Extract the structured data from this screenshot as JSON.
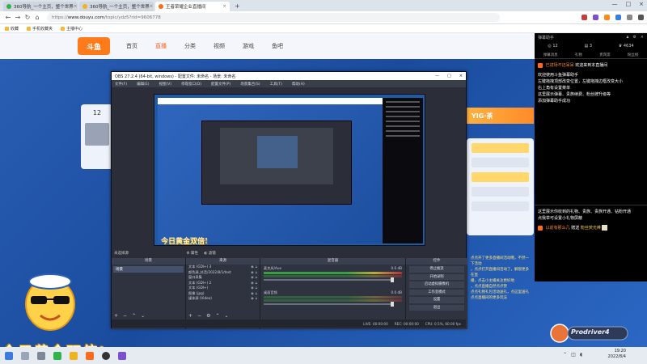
{
  "browser": {
    "tabs": [
      {
        "title": "360导航_一个主页，整个世界",
        "color": "#2fb34b",
        "active": false
      },
      {
        "title": "360导航_一个主页，整个世界",
        "color": "#f0b31e",
        "active": false
      },
      {
        "title": "王者荣耀企业直播间",
        "color": "#ff6a1a",
        "active": true
      }
    ],
    "newtab": "+",
    "url_prefix": "https://",
    "url_host": "www.douyu.com",
    "url_path": "/topic/ydz5?rid=9606778",
    "bookmarks": [
      "收藏",
      "手机收藏夹",
      "主播中心"
    ],
    "nav": {
      "back": "←",
      "forward": "→",
      "reload": "↻",
      "home": "⌂"
    }
  },
  "site": {
    "logo": "斗鱼",
    "nav": [
      "首页",
      "直播",
      "分类",
      "视频",
      "游戏",
      "鱼吧"
    ],
    "active_nav": 1,
    "left_card_num": "12",
    "yig_banner": "YIG·茶",
    "promo_lines": [
      "点点开了更多直播间活动哦，不然一下活动",
      "，点点打开直播间活动了，解锁更多在直",
      "播，点击小主播关注更好地",
      "，点点直播自然点点赞",
      "点点礼物礼包活动送礼，点这里送礼",
      "点点直播间的更多玩法"
    ],
    "gold_text": "今日黄金双倍!",
    "brand": "Prodriver4"
  },
  "obs": {
    "title": "OBS 27.2.4 (64-bit, windows) - 配置文件: 未命名 - 场景: 未命名",
    "menu": [
      "文件(F)",
      "编辑(E)",
      "视图(V)",
      "停靠窗口(D)",
      "配置文件(P)",
      "场景集合(S)",
      "工具(T)",
      "帮助(H)"
    ],
    "preview_label": "未选择源",
    "filter_buttons": [
      "属性",
      "滤镜"
    ],
    "panels": {
      "scenes": "场景",
      "sources": "来源",
      "mixer": "混音器",
      "controls": "控件"
    },
    "scene_items": [
      "场景"
    ],
    "sources": [
      "文本 (GDI+) 3",
      "颜色源_抖音/2022/8/1/test",
      "窗口采集",
      "文本 (GDI+) 2",
      "文本 (GDI+)",
      "图像 (jpg)",
      "媒体源 (Video)"
    ],
    "mixer_channels": [
      {
        "name": "麦克风/Aux",
        "db": "0.0 dB"
      },
      {
        "name": "桌面音频",
        "db": "0.0 dB"
      }
    ],
    "controls": [
      "停止推流",
      "开始录制",
      "启动虚拟摄像机",
      "工作室模式",
      "设置",
      "退出"
    ],
    "status": [
      "LIVE: 00:00:00",
      "REC: 00:00:00",
      "CPU: 0.5%, 60.00 fps"
    ],
    "mini_gold": "今日黄金双倍!"
  },
  "chat": {
    "header": "弹幕助手",
    "stats": [
      "12",
      "3",
      "4634"
    ],
    "tabs": [
      "弹幕消息",
      "礼物",
      "贵宾席",
      "粉丝榜"
    ],
    "messages": [
      {
        "prefix": "已进场",
        "name": "不迈呆呆",
        "text": "欢迎来到本直播间"
      },
      {
        "text": "欢迎使用斗鱼弹幕助手"
      },
      {
        "text": "左键拖拽顶部改变位置，左键拖拽边框改变大小"
      },
      {
        "text": "右上角有设置菜单"
      },
      {
        "text": "这里展示弹幕、贵族续费、粉丝牌升级等"
      },
      {
        "text": "添加弹幕助手成功"
      }
    ],
    "lower_messages": [
      {
        "text": "这里展示你收到的礼物、贵族、贵族开通、钻粉开通"
      },
      {
        "text": "点我举可设置小礼物屏蔽"
      },
      {
        "name": "以前有那么几",
        "verb": "赠送",
        "gift": "粉丝荧光棒"
      }
    ]
  },
  "taskbar": {
    "time": "19:20",
    "date": "2022/8/4"
  }
}
